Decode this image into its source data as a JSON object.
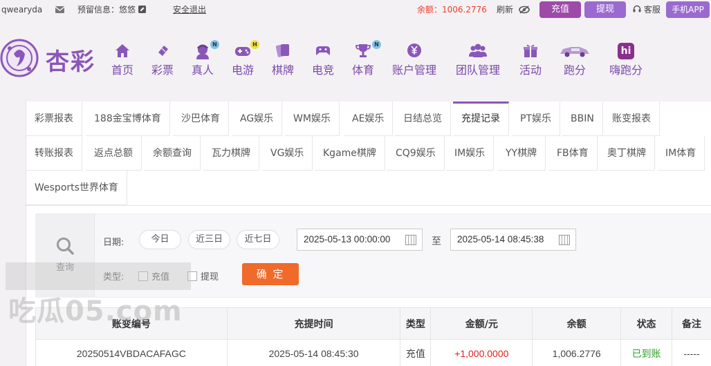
{
  "topbar": {
    "username": "qwearyda",
    "reserve_info_label": "预留信息：悠悠",
    "logout": "安全退出",
    "balance_label": "余额：",
    "balance_value": "1006.2776",
    "refresh": "刷新",
    "deposit_button": "充值",
    "withdraw_button": "提现",
    "service": "客服",
    "mobile_app": "手机APP"
  },
  "logo_text": "杏彩",
  "nav": [
    {
      "label": "首页",
      "icon": "home-icon"
    },
    {
      "label": "彩票",
      "icon": "ticket-icon"
    },
    {
      "label": "真人",
      "icon": "dealer-icon",
      "badge": "N"
    },
    {
      "label": "电游",
      "icon": "gamepad-icon",
      "badge": "H"
    },
    {
      "label": "棋牌",
      "icon": "cards-icon"
    },
    {
      "label": "电竞",
      "icon": "esports-icon"
    },
    {
      "label": "体育",
      "icon": "trophy-icon",
      "badge": "N"
    },
    {
      "label": "账户管理",
      "icon": "yen-icon"
    },
    {
      "label": "团队管理",
      "icon": "team-icon"
    },
    {
      "label": "活动",
      "icon": "gift-icon"
    },
    {
      "label": "跑分",
      "icon": "car-icon"
    },
    {
      "label": "嗨跑分",
      "icon": "hi-icon",
      "icon_text": "hi"
    }
  ],
  "tabs_row1": [
    "彩票报表",
    "188金宝博体育",
    "沙巴体育",
    "AG娱乐",
    "WM娱乐",
    "AE娱乐",
    "日结总览",
    "充提记录",
    "PT娱乐",
    "BBIN",
    "账变报表"
  ],
  "tabs_row2": [
    "转账报表",
    "返点总额",
    "余额查询",
    "瓦力棋牌",
    "VG娱乐",
    "Kgame棋牌",
    "CQ9娱乐",
    "IM娱乐",
    "YY棋牌",
    "FB体育",
    "奥丁棋牌",
    "IM体育"
  ],
  "tabs_row3": [
    "Wesports世界体育"
  ],
  "active_tab": "充提记录",
  "filter": {
    "query_label": "查询",
    "date_label": "日期:",
    "quick_ranges": [
      "今日",
      "近三日",
      "近七日"
    ],
    "start_date": "2025-05-13 00:00:00",
    "to_label": "至",
    "end_date": "2025-05-14 08:45:38",
    "type_label": "类型:",
    "type_options": [
      "充值",
      "提现"
    ],
    "confirm_button": "确 定"
  },
  "table": {
    "headers": [
      "账变编号",
      "充提时间",
      "类型",
      "金额/元",
      "余额",
      "状态",
      "备注"
    ],
    "rows": [
      [
        "20250514VBDACAFAGC",
        "2025-05-14 08:45:30",
        "充值",
        "+1,000.0000",
        "1,006.2776",
        "已到账",
        "-----"
      ]
    ]
  },
  "watermark_text": "吃瓜05.com",
  "colors": {
    "brand_purple": "#8a57b8",
    "balance_red": "#e8412a",
    "amount_red": "#e02020",
    "status_green": "#2e9e2e",
    "confirm_orange": "#f06a2a"
  }
}
